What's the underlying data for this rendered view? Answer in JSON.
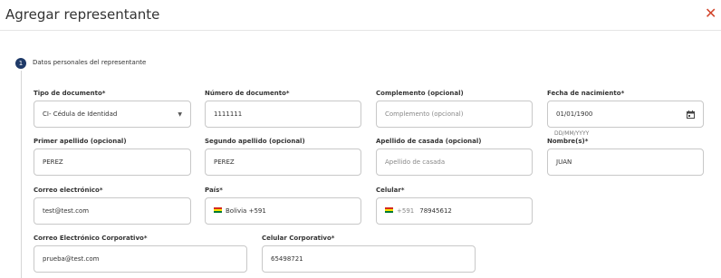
{
  "modal": {
    "title": "Agregar representante"
  },
  "step": {
    "number": "1",
    "label": "Datos personales del representante"
  },
  "fields": {
    "tipo_documento": {
      "label": "Tipo de documento*",
      "value": "CI- Cédula de Identidad"
    },
    "numero_documento": {
      "label": "Número de documento*",
      "value": "1111111"
    },
    "complemento": {
      "label": "Complemento (opcional)",
      "placeholder": "Complemento (opcional)"
    },
    "fecha_nacimiento": {
      "label": "Fecha de nacimiento*",
      "value": "01/01/1900",
      "hint": "DD/MM/YYYY"
    },
    "primer_apellido": {
      "label": "Primer apellido (opcional)",
      "value": "PEREZ"
    },
    "segundo_apellido": {
      "label": "Segundo apellido (opcional)",
      "value": "PEREZ"
    },
    "apellido_casada": {
      "label": "Apellido de casada (opcional)",
      "placeholder": "Apellido de casada"
    },
    "nombres": {
      "label": "Nombre(s)*",
      "value": "JUAN"
    },
    "correo": {
      "label": "Correo electrónico*",
      "value": "test@test.com"
    },
    "pais": {
      "label": "País*",
      "value": "Bolivia +591"
    },
    "celular": {
      "label": "Celular*",
      "code": "+591",
      "value": "78945612"
    },
    "correo_corporativo": {
      "label": "Correo Electrónico Corporativo*",
      "value": "prueba@test.com"
    },
    "celular_corporativo": {
      "label": "Celular Corporativo*",
      "value": "65498721"
    }
  },
  "colors": {
    "close": "#d2452c",
    "step": "#1f3a68",
    "border": "#c8c8c8"
  }
}
